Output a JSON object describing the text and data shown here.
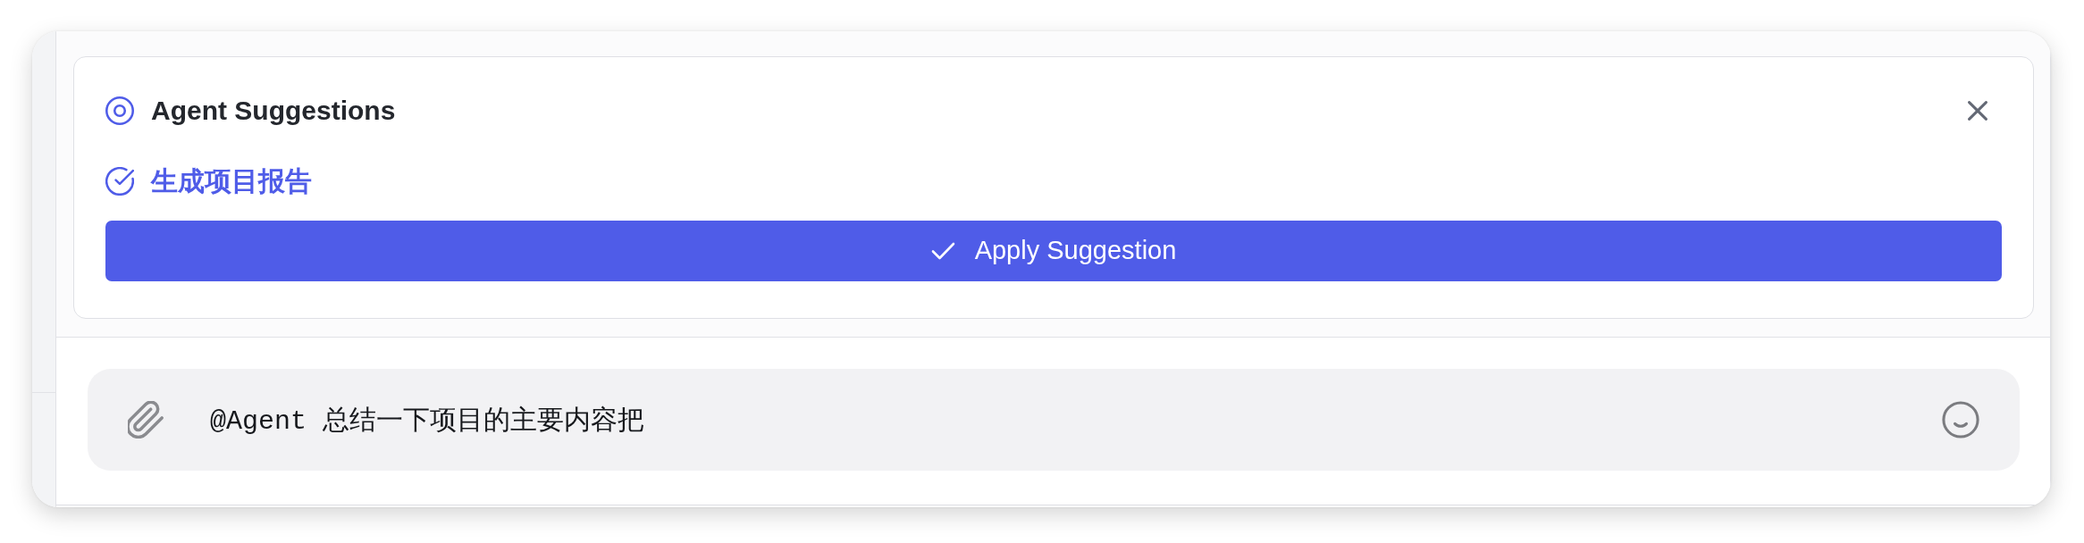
{
  "suggestions_panel": {
    "title": "Agent Suggestions",
    "suggestions": [
      {
        "label": "生成项目报告"
      }
    ],
    "apply_button": "Apply Suggestion"
  },
  "composer": {
    "value": "@Agent 总结一下项目的主要内容把"
  }
}
